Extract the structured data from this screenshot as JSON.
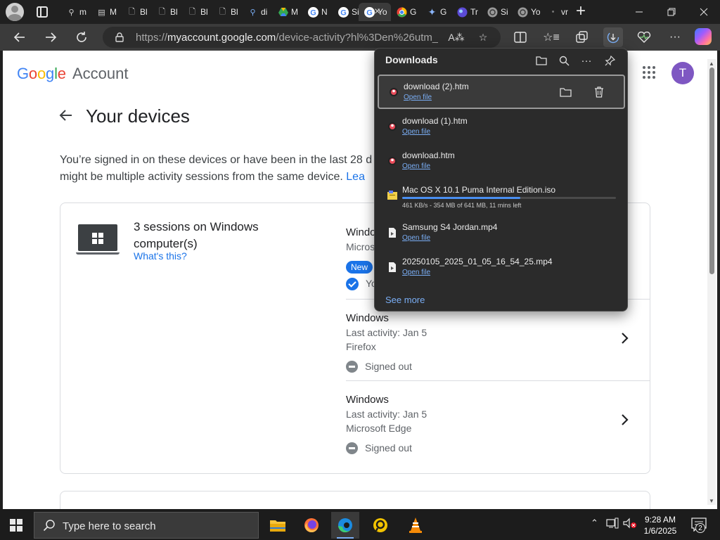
{
  "browser": {
    "tabs": [
      {
        "label": "m",
        "icon": "search-icon"
      },
      {
        "label": "M",
        "icon": "pdf-icon"
      },
      {
        "label": "Bl",
        "icon": "document-icon"
      },
      {
        "label": "Bl",
        "icon": "document-icon"
      },
      {
        "label": "Bl",
        "icon": "document-icon"
      },
      {
        "label": "Bl",
        "icon": "document-icon"
      },
      {
        "label": "di",
        "icon": "search-icon"
      },
      {
        "label": "M",
        "icon": "drive-icon"
      },
      {
        "label": "N",
        "icon": "google-icon"
      },
      {
        "label": "Si",
        "icon": "google-icon"
      },
      {
        "label": "Yo",
        "icon": "google-icon",
        "active": true
      },
      {
        "label": "G",
        "icon": "chrome-icon"
      },
      {
        "label": "G",
        "icon": "gemini-icon"
      },
      {
        "label": "Tr",
        "icon": "web-icon"
      },
      {
        "label": "Si",
        "icon": "chatgpt-icon"
      },
      {
        "label": "Yo",
        "icon": "chatgpt-icon"
      },
      {
        "label": "vr",
        "icon": "blank-icon"
      }
    ],
    "url_prefix": "https://",
    "url_host": "myaccount.google.com",
    "url_rest": "/device-activity?hl%3Den%26utm_so..."
  },
  "page": {
    "logo_letters": [
      "G",
      "o",
      "o",
      "g",
      "l",
      "e"
    ],
    "logo_colors": [
      "#4285f4",
      "#ea4335",
      "#fbbc05",
      "#4285f4",
      "#34a853",
      "#ea4335"
    ],
    "product": "Account",
    "avatar_letter": "T",
    "title": "Your devices",
    "intro_line1": "You’re signed in on these devices or have been in the last 28 d",
    "intro_line2": "might be multiple activity sessions from the same device.",
    "intro_link": "Lea",
    "session_title": "3 sessions on Windows computer(s)",
    "whats_this": "What's this?",
    "devices": [
      {
        "name": "Windo",
        "sub1": "Micros",
        "sub2": ""
      },
      {
        "name": "Windows",
        "sub1": "Last activity: Jan 5",
        "sub2": "Firefox",
        "status": "Signed out"
      },
      {
        "name": "Windows",
        "sub1": "Last activity: Jan 5",
        "sub2": "Microsoft Edge",
        "status": "Signed out"
      }
    ],
    "new_badge": "New",
    "current_text": "Yo"
  },
  "downloads": {
    "title": "Downloads",
    "items": [
      {
        "name": "download (2).htm",
        "action": "Open file",
        "icon": "browser-file-icon"
      },
      {
        "name": "download (1).htm",
        "action": "Open file",
        "icon": "browser-file-icon"
      },
      {
        "name": "download.htm",
        "action": "Open file",
        "icon": "browser-file-icon"
      },
      {
        "name": "Mac OS X 10.1 Puma Internal Edition.iso",
        "status": "461 KB/s - 354 MB of 641 MB, 11 mins left",
        "progress": 0.552,
        "icon": "iso-file-icon"
      },
      {
        "name": "Samsung S4 Jordan.mp4",
        "action": "Open file",
        "icon": "video-file-icon"
      },
      {
        "name": "20250105_2025_01_05_16_54_25.mp4",
        "action": "Open file",
        "icon": "video-file-icon"
      }
    ],
    "see_more": "See more"
  },
  "taskbar": {
    "search_placeholder": "Type here to search",
    "time": "9:28 AM",
    "date": "1/6/2025",
    "notification_count": "2"
  }
}
